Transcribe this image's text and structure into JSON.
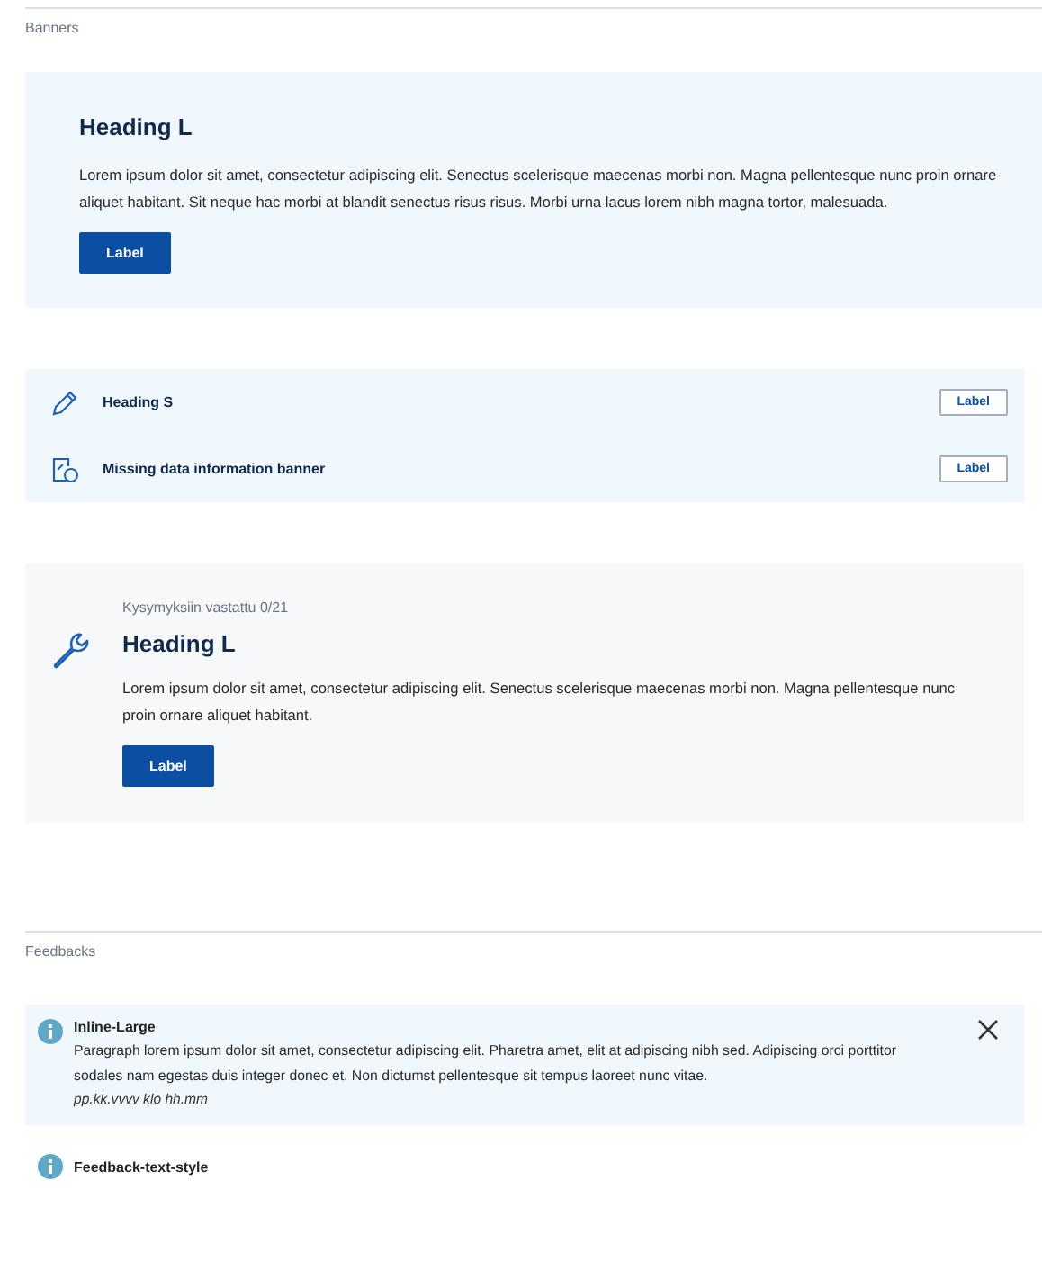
{
  "sections": [
    {
      "title": "Banners",
      "banners": [
        {
          "kind": "large",
          "heading": "Heading L",
          "text": "Lorem ipsum dolor sit amet, consectetur adipiscing elit. Senectus scelerisque maecenas morbi non. Magna pellentesque nunc proin ornare aliquet habitant. Sit neque hac morbi at blandit senectus risus risus. Morbi urna lacus lorem nibh magna tortor, malesuada.",
          "button": "Label"
        },
        {
          "kind": "small-edit",
          "heading": "Heading S",
          "button": "Label"
        },
        {
          "kind": "small-missing-data",
          "heading": "Missing data information banner",
          "button": "Label"
        },
        {
          "kind": "progress",
          "caption": "Kysymyksiin vastattu 0/21",
          "heading": "Heading L",
          "text": "Lorem ipsum dolor sit amet, consectetur adipiscing elit. Senectus scelerisque maecenas morbi non. Magna pellentesque nunc proin ornare aliquet habitant.",
          "button": "Label"
        }
      ]
    },
    {
      "title": "Feedbacks",
      "feedbacks": [
        {
          "kind": "inline-large",
          "heading": "Inline-Large",
          "text": "Paragraph lorem ipsum dolor sit amet, consectetur adipiscing elit. Pharetra amet, elit at adipiscing nibh sed. Adipiscing orci porttitor sodales nam egestas duis integer donec et. Non dictumst pellentesque sit tempus laoreet nunc vitae.",
          "timestamp": "pp.kk.vvvv klo hh.mm",
          "closable": true
        },
        {
          "kind": "text-style",
          "heading": "Feedback-text-style"
        }
      ]
    }
  ]
}
